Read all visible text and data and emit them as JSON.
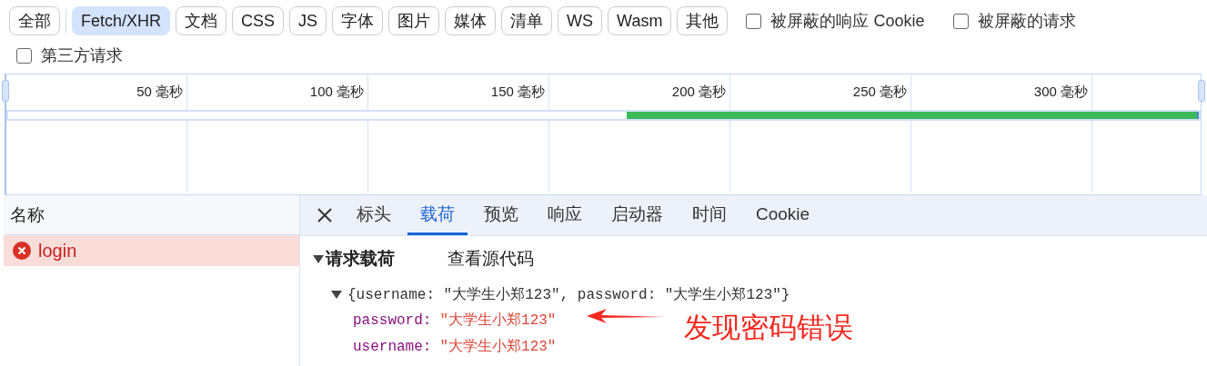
{
  "filters": [
    {
      "label": "全部",
      "selected": false
    },
    {
      "label": "Fetch/XHR",
      "selected": true
    },
    {
      "label": "文档",
      "selected": false
    },
    {
      "label": "CSS",
      "selected": false
    },
    {
      "label": "JS",
      "selected": false
    },
    {
      "label": "字体",
      "selected": false
    },
    {
      "label": "图片",
      "selected": false
    },
    {
      "label": "媒体",
      "selected": false
    },
    {
      "label": "清单",
      "selected": false
    },
    {
      "label": "WS",
      "selected": false
    },
    {
      "label": "Wasm",
      "selected": false
    },
    {
      "label": "其他",
      "selected": false
    }
  ],
  "checkboxes": [
    {
      "label": "被屏蔽的响应 Cookie",
      "checked": false
    },
    {
      "label": "被屏蔽的请求",
      "checked": false
    },
    {
      "label": "第三方请求",
      "checked": false
    }
  ],
  "timeline": {
    "ticks": [
      "50 毫秒",
      "100 毫秒",
      "150 毫秒",
      "200 毫秒",
      "250 毫秒",
      "300 毫秒"
    ]
  },
  "requests": {
    "header": "名称",
    "rows": [
      {
        "name": "login",
        "error": true,
        "selected": true
      }
    ]
  },
  "detail": {
    "tabs": [
      {
        "label": "标头",
        "selected": false
      },
      {
        "label": "载荷",
        "selected": true
      },
      {
        "label": "预览",
        "selected": false
      },
      {
        "label": "响应",
        "selected": false
      },
      {
        "label": "启动器",
        "selected": false
      },
      {
        "label": "时间",
        "selected": false
      },
      {
        "label": "Cookie",
        "selected": false
      }
    ],
    "section": {
      "title": "请求载荷",
      "expanded": true,
      "action": "查看源代码"
    },
    "payload": {
      "summary": "{username: \"大学生小郑123\", password: \"大学生小郑123\"}",
      "expanded": true,
      "fields": [
        {
          "key": "password:",
          "value": "\"大学生小郑123\""
        },
        {
          "key": "username:",
          "value": "\"大学生小郑123\""
        }
      ]
    }
  },
  "annotation": {
    "text": "发现密码错误"
  }
}
